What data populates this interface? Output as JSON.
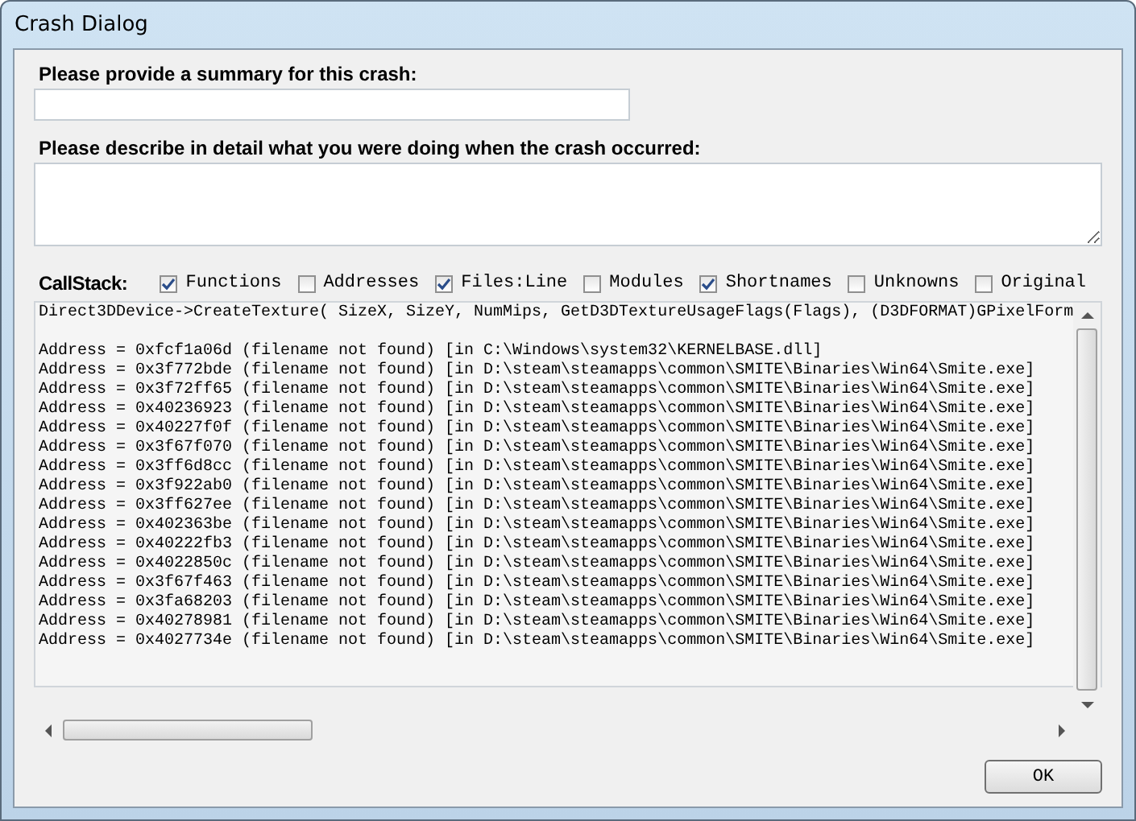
{
  "window": {
    "title": "Crash Dialog"
  },
  "summary": {
    "label": "Please provide a summary for this crash:"
  },
  "description": {
    "label": "Please describe in detail what you were doing when the crash occurred:"
  },
  "callstack": {
    "label": "CallStack:",
    "options": [
      {
        "label": "Functions",
        "checked": true
      },
      {
        "label": "Addresses",
        "checked": false
      },
      {
        "label": "Files:Line",
        "checked": true
      },
      {
        "label": "Modules",
        "checked": false
      },
      {
        "label": "Shortnames",
        "checked": true
      },
      {
        "label": "Unknowns",
        "checked": false
      },
      {
        "label": "Original",
        "checked": false
      }
    ],
    "lines": [
      "Direct3DDevice->CreateTexture( SizeX, SizeY, NumMips, GetD3DTextureUsageFlags(Flags), (D3DFORMAT)GPixelForm",
      "Address = 0xfcf1a06d (filename not found) [in C:\\Windows\\system32\\KERNELBASE.dll]",
      "Address = 0x3f772bde (filename not found) [in D:\\steam\\steamapps\\common\\SMITE\\Binaries\\Win64\\Smite.exe]",
      "Address = 0x3f72ff65 (filename not found) [in D:\\steam\\steamapps\\common\\SMITE\\Binaries\\Win64\\Smite.exe]",
      "Address = 0x40236923 (filename not found) [in D:\\steam\\steamapps\\common\\SMITE\\Binaries\\Win64\\Smite.exe]",
      "Address = 0x40227f0f (filename not found) [in D:\\steam\\steamapps\\common\\SMITE\\Binaries\\Win64\\Smite.exe]",
      "Address = 0x3f67f070 (filename not found) [in D:\\steam\\steamapps\\common\\SMITE\\Binaries\\Win64\\Smite.exe]",
      "Address = 0x3ff6d8cc (filename not found) [in D:\\steam\\steamapps\\common\\SMITE\\Binaries\\Win64\\Smite.exe]",
      "Address = 0x3f922ab0 (filename not found) [in D:\\steam\\steamapps\\common\\SMITE\\Binaries\\Win64\\Smite.exe]",
      "Address = 0x3ff627ee (filename not found) [in D:\\steam\\steamapps\\common\\SMITE\\Binaries\\Win64\\Smite.exe]",
      "Address = 0x402363be (filename not found) [in D:\\steam\\steamapps\\common\\SMITE\\Binaries\\Win64\\Smite.exe]",
      "Address = 0x40222fb3 (filename not found) [in D:\\steam\\steamapps\\common\\SMITE\\Binaries\\Win64\\Smite.exe]",
      "Address = 0x4022850c (filename not found) [in D:\\steam\\steamapps\\common\\SMITE\\Binaries\\Win64\\Smite.exe]",
      "Address = 0x3f67f463 (filename not found) [in D:\\steam\\steamapps\\common\\SMITE\\Binaries\\Win64\\Smite.exe]",
      "Address = 0x3fa68203 (filename not found) [in D:\\steam\\steamapps\\common\\SMITE\\Binaries\\Win64\\Smite.exe]",
      "Address = 0x40278981 (filename not found) [in D:\\steam\\steamapps\\common\\SMITE\\Binaries\\Win64\\Smite.exe]",
      "Address = 0x4027734e (filename not found) [in D:\\steam\\steamapps\\common\\SMITE\\Binaries\\Win64\\Smite.exe]"
    ]
  },
  "buttons": [
    {
      "label": "OK"
    }
  ]
}
